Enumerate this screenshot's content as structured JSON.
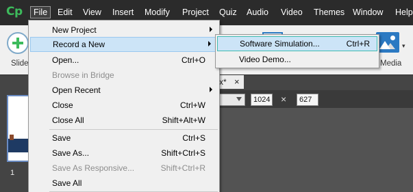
{
  "app": {
    "logo": "Cp"
  },
  "menubar": {
    "items": [
      "File",
      "Edit",
      "View",
      "Insert",
      "Modify",
      "Project",
      "Quiz",
      "Audio",
      "Video",
      "Themes",
      "Window",
      "Help"
    ],
    "active": "File"
  },
  "toolbar": {
    "slide_label": "Slide",
    "media_label": "Media"
  },
  "document": {
    "tab_label": "x*",
    "tab_close": "×",
    "width": "1024",
    "height": "627",
    "times": "×",
    "slide_number": "1"
  },
  "file_menu": {
    "items": [
      {
        "label": "New Project",
        "shortcut": "",
        "submenu": true,
        "disabled": false
      },
      {
        "label": "Record a New",
        "shortcut": "",
        "submenu": true,
        "disabled": false,
        "highlighted": true
      },
      {
        "label": "Open...",
        "shortcut": "Ctrl+O",
        "submenu": false,
        "disabled": false
      },
      {
        "label": "Browse in Bridge",
        "shortcut": "",
        "submenu": false,
        "disabled": true
      },
      {
        "label": "Open Recent",
        "shortcut": "",
        "submenu": true,
        "disabled": false
      },
      {
        "label": "Close",
        "shortcut": "Ctrl+W",
        "submenu": false,
        "disabled": false
      },
      {
        "label": "Close All",
        "shortcut": "Shift+Alt+W",
        "submenu": false,
        "disabled": false
      },
      {
        "label": "Save",
        "shortcut": "Ctrl+S",
        "submenu": false,
        "disabled": false
      },
      {
        "label": "Save As...",
        "shortcut": "Shift+Ctrl+S",
        "submenu": false,
        "disabled": false
      },
      {
        "label": "Save As Responsive...",
        "shortcut": "Shift+Ctrl+R",
        "submenu": false,
        "disabled": true
      },
      {
        "label": "Save All",
        "shortcut": "",
        "submenu": false,
        "disabled": false
      }
    ]
  },
  "record_submenu": {
    "items": [
      {
        "label": "Software Simulation...",
        "shortcut": "Ctrl+R",
        "highlighted": true
      },
      {
        "label": "Video Demo...",
        "shortcut": ""
      }
    ]
  },
  "colors": {
    "logo_green": "#3dbb5c",
    "menubar_bg": "#2b2b2b",
    "highlight_bg": "#cce4f7",
    "highlight_border": "#99c8ef",
    "sub_highlight_border": "#3dbbb0"
  }
}
